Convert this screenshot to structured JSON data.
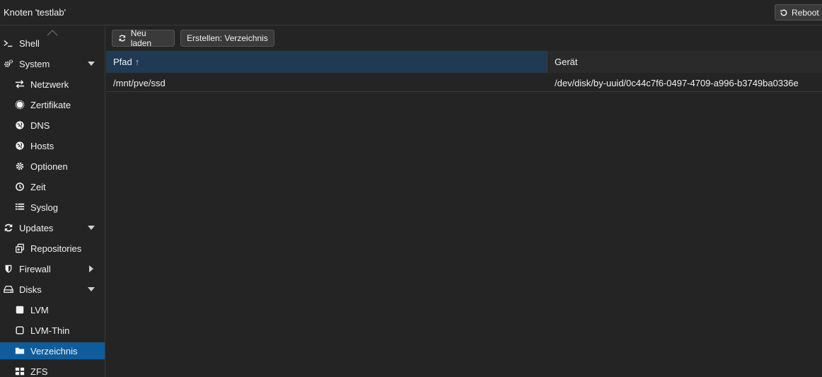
{
  "header": {
    "title": "Knoten 'testlab'",
    "reboot_label": "Reboot"
  },
  "sidebar": {
    "items": [
      {
        "label": "Shell",
        "icon": "terminal-icon",
        "level": 0
      },
      {
        "label": "System",
        "icon": "cogs-icon",
        "level": 0,
        "expand": "down"
      },
      {
        "label": "Netzwerk",
        "icon": "exchange-icon",
        "level": 1
      },
      {
        "label": "Zertifikate",
        "icon": "certificate-icon",
        "level": 1
      },
      {
        "label": "DNS",
        "icon": "globe-icon",
        "level": 1
      },
      {
        "label": "Hosts",
        "icon": "globe-icon",
        "level": 1
      },
      {
        "label": "Optionen",
        "icon": "gear-icon",
        "level": 1
      },
      {
        "label": "Zeit",
        "icon": "clock-icon",
        "level": 1
      },
      {
        "label": "Syslog",
        "icon": "list-icon",
        "level": 1
      },
      {
        "label": "Updates",
        "icon": "refresh-icon",
        "level": 0,
        "expand": "down"
      },
      {
        "label": "Repositories",
        "icon": "repositories-icon",
        "level": 1
      },
      {
        "label": "Firewall",
        "icon": "shield-icon",
        "level": 0,
        "expand": "right"
      },
      {
        "label": "Disks",
        "icon": "hdd-icon",
        "level": 0,
        "expand": "down"
      },
      {
        "label": "LVM",
        "icon": "square-icon",
        "level": 1
      },
      {
        "label": "LVM-Thin",
        "icon": "square-outline-icon",
        "level": 1
      },
      {
        "label": "Verzeichnis",
        "icon": "folder-icon",
        "level": 1,
        "active": true
      },
      {
        "label": "ZFS",
        "icon": "th-large-icon",
        "level": 1
      }
    ]
  },
  "toolbar": {
    "reload_label": "Neu laden",
    "create_label": "Erstellen: Verzeichnis"
  },
  "grid": {
    "columns": [
      {
        "label": "Pfad",
        "sort": "↑"
      },
      {
        "label": "Gerät"
      }
    ],
    "rows": [
      {
        "path": "/mnt/pve/ssd",
        "device": "/dev/disk/by-uuid/0c44c7f6-0497-4709-a996-b3749ba0336e"
      }
    ]
  },
  "colors": {
    "background": "#242424",
    "active": "#0d5d9e",
    "header_sorted": "#1f3a52"
  }
}
